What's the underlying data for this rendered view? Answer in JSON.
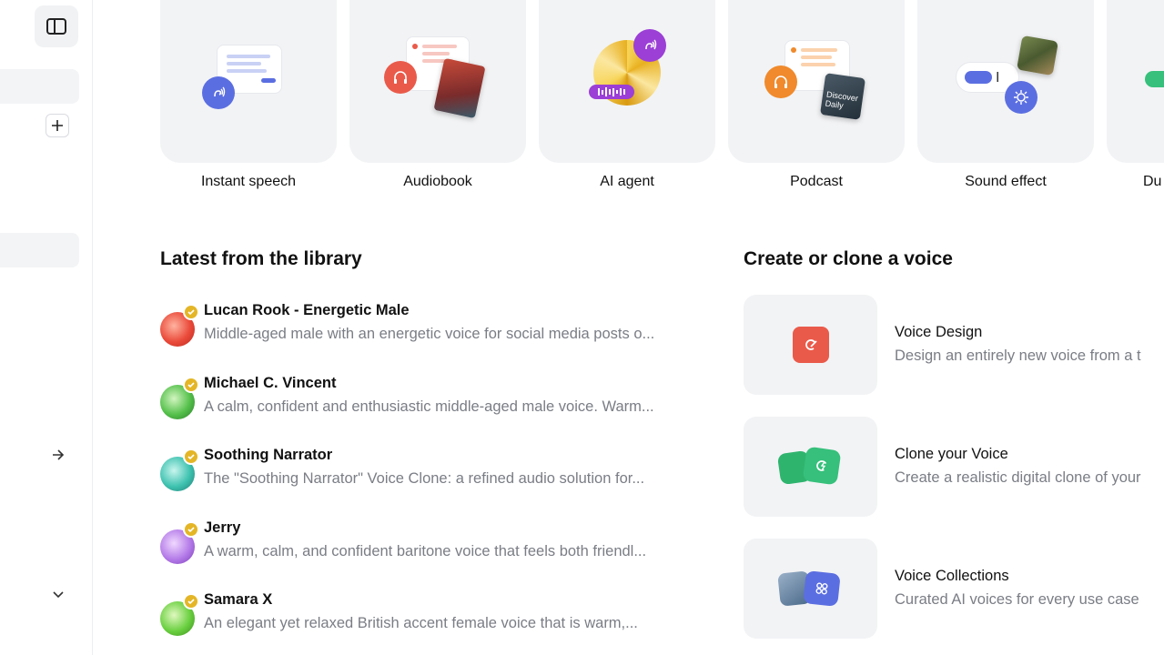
{
  "tiles": [
    {
      "label": "Instant speech"
    },
    {
      "label": "Audiobook"
    },
    {
      "label": "AI agent"
    },
    {
      "label": "Podcast"
    },
    {
      "label": "Sound effect"
    },
    {
      "label": "Du"
    }
  ],
  "library": {
    "title": "Latest from the library",
    "items": [
      {
        "name": "Lucan Rook - Energetic Male",
        "desc": "Middle-aged male with an energetic voice for social media posts o..."
      },
      {
        "name": "Michael C. Vincent",
        "desc": "A calm, confident and enthusiastic middle-aged male voice. Warm..."
      },
      {
        "name": "Soothing Narrator",
        "desc": "The \"Soothing Narrator\" Voice Clone: a refined audio solution for..."
      },
      {
        "name": "Jerry",
        "desc": "A warm, calm, and confident baritone voice that feels both friendl..."
      },
      {
        "name": "Samara X",
        "desc": "An elegant yet relaxed British accent female voice that is warm,..."
      }
    ]
  },
  "create": {
    "title": "Create or clone a voice",
    "items": [
      {
        "title": "Voice Design",
        "desc": "Design an entirely new voice from a t"
      },
      {
        "title": "Clone your Voice",
        "desc": "Create a realistic digital clone of your"
      },
      {
        "title": "Voice Collections",
        "desc": "Curated AI voices for every use case"
      }
    ]
  },
  "podcast_cover_text": "Discover Daily",
  "colors": {
    "accent_blue": "#5b6ee1",
    "red": "#ea5a4a",
    "orange": "#f08a2c",
    "purple": "#9b3fd6",
    "green": "#36c07b",
    "badge_gold": "#e4b627"
  }
}
